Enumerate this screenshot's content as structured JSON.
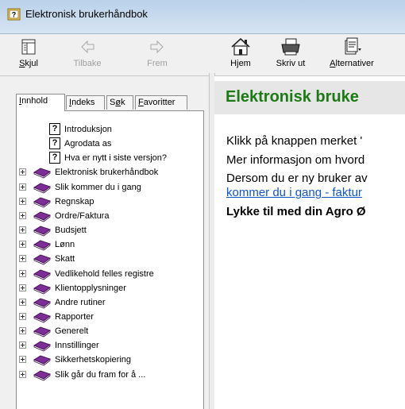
{
  "window": {
    "title": "Elektronisk brukerhåndbok"
  },
  "toolbar": {
    "buttons": [
      {
        "label_pre": "",
        "label_u": "S",
        "label_post": "kjul",
        "icon": "hide-pane-icon",
        "disabled": false
      },
      {
        "label_pre": "Tilbake",
        "label_u": "",
        "label_post": "",
        "icon": "back-arrow-icon",
        "disabled": true
      },
      {
        "label_pre": "Frem",
        "label_u": "",
        "label_post": "",
        "icon": "forward-arrow-icon",
        "disabled": true
      },
      {
        "label_pre": "H",
        "label_u": "j",
        "label_post": "em",
        "icon": "home-icon",
        "disabled": false
      },
      {
        "label_pre": "Skriv ut",
        "label_u": "",
        "label_post": "",
        "icon": "printer-icon",
        "disabled": false
      },
      {
        "label_pre": "",
        "label_u": "A",
        "label_post": "lternativer",
        "icon": "options-icon",
        "disabled": false
      }
    ]
  },
  "tabs": [
    {
      "u": "I",
      "rest": "nnhold"
    },
    {
      "u": "I",
      "rest": "ndeks"
    },
    {
      "pre": "S",
      "u": "ø",
      "rest": "k"
    },
    {
      "u": "F",
      "rest": "avoritter"
    }
  ],
  "tree": {
    "topics": [
      "Introduksjon",
      "Agrodata as",
      "Hva er nytt i siste versjon?"
    ],
    "books": [
      "Elektronisk brukerhåndbok",
      "Slik kommer du i gang",
      "Regnskap",
      "Ordre/Faktura",
      "Budsjett",
      "Lønn",
      "Skatt",
      "Vedlikehold felles registre",
      "Klientopplysninger",
      "Andre rutiner",
      "Rapporter",
      "Generelt",
      "Innstillinger",
      "Sikkerhetskopiering",
      "Slik går du fram for å ..."
    ]
  },
  "content": {
    "heading": "Elektronisk bruke",
    "line1": "Klikk på knappen merket '",
    "line2": "Mer informasjon om hvord",
    "line3": "Dersom du er ny bruker av",
    "link": "kommer du i gang - faktur",
    "bold": "Lykke til med din Agro Ø"
  },
  "colors": {
    "heading_green": "#1b7a13",
    "link_blue": "#1155cc",
    "book_purple": "#7d2d96"
  }
}
